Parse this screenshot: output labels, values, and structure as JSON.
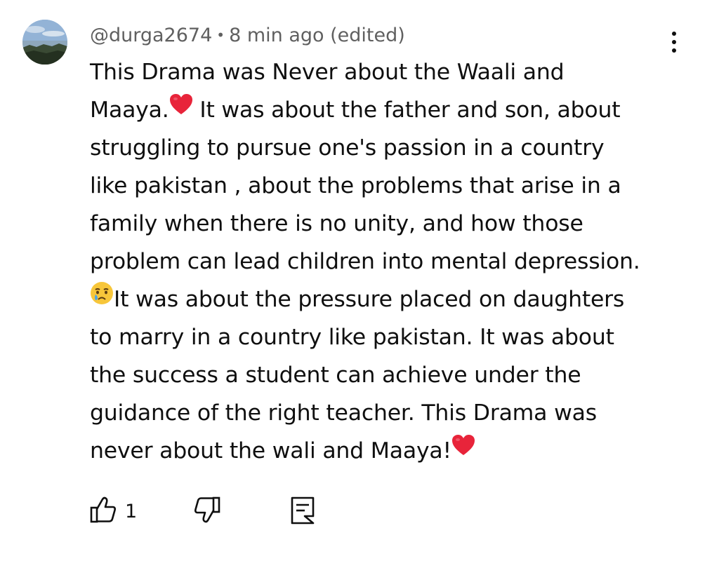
{
  "comment": {
    "author": "@durga2674",
    "separator": "•",
    "time": "8 min ago (edited)",
    "lines": [
      "This Drama was Never about the Waali and",
      "Maaya.",
      " It was about the father and son, about",
      "struggling to pursue one's passion in a country",
      "like pakistan , about the problems that arise in a",
      "family when there is no unity, and how those",
      "problem can lead children into mental depression.",
      "It was about the pressure placed on daughters",
      "to marry in a country like pakistan. It was about",
      "the success a student can achieve under the",
      "guidance of the right teacher. This Drama was",
      "never about the wali and Maaya!"
    ],
    "like_count": "1"
  },
  "icons": {
    "avatar": "profile-photo",
    "menu": "more-vert-icon",
    "heart": "red-heart-emoji",
    "crying": "crying-face-emoji",
    "like": "thumb-up-icon",
    "dislike": "thumb-down-icon",
    "reply": "reply-comment-icon"
  },
  "colors": {
    "text": "#0f0f0f",
    "meta": "#606060",
    "heart": "#e8243a",
    "emoji_face": "#f7c63a",
    "tear": "#4aa3e8"
  }
}
